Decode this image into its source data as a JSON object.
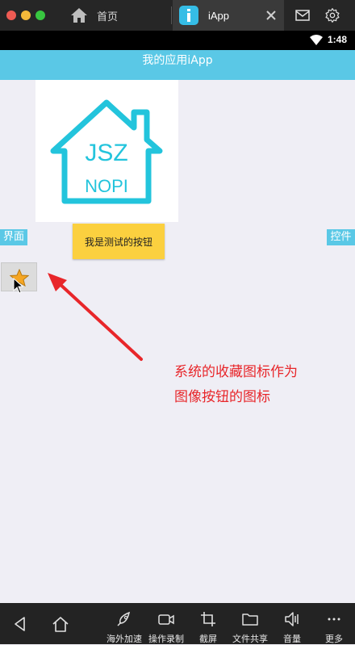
{
  "window": {
    "tabs": [
      {
        "label": "首页",
        "icon": "home-icon"
      },
      {
        "label": "iApp",
        "icon": "iapp-icon"
      }
    ]
  },
  "status": {
    "time": "1:48"
  },
  "app": {
    "title": "我的应用iApp",
    "logo": {
      "line1": "JSZ",
      "line2": "NOPI"
    },
    "left_button": "界面",
    "test_button": "我是测试的按钮",
    "right_button": "控件",
    "annotation": {
      "line1": "系统的收藏图标作为",
      "line2": "图像按钮的图标"
    }
  },
  "toolbar": {
    "items": [
      {
        "label": "海外加速",
        "icon": "rocket-icon"
      },
      {
        "label": "操作录制",
        "icon": "video-icon"
      },
      {
        "label": "截屏",
        "icon": "crop-icon"
      },
      {
        "label": "文件共享",
        "icon": "folder-icon"
      },
      {
        "label": "音量",
        "icon": "volume-icon"
      },
      {
        "label": "更多",
        "icon": "more-icon"
      }
    ]
  },
  "colors": {
    "accent": "#5ac8e6",
    "button_yellow": "#fbd03f",
    "annotation_red": "#e8262a",
    "logo_cyan": "#23c4dc"
  }
}
